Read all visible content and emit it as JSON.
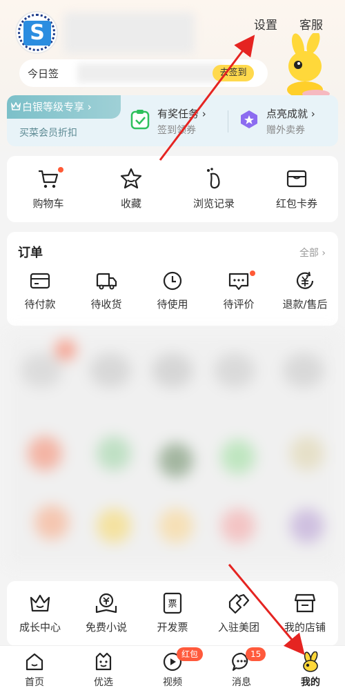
{
  "header": {
    "settings_label": "设置",
    "service_label": "客服",
    "checkin_text": "今日签",
    "checkin_button": "去签到"
  },
  "vip": {
    "tag_label": "白银等级专享 ›",
    "tag_sub": "买菜会员折扣",
    "tasks_title": "有奖任务 ›",
    "tasks_sub": "签到领券",
    "achieve_title": "点亮成就 ›",
    "achieve_sub": "赠外卖券"
  },
  "quick": {
    "items": [
      {
        "label": "购物车",
        "icon": "cart-icon"
      },
      {
        "label": "收藏",
        "icon": "star-icon"
      },
      {
        "label": "浏览记录",
        "icon": "footprint-icon"
      },
      {
        "label": "红包卡券",
        "icon": "coupon-icon"
      }
    ]
  },
  "orders": {
    "title": "订单",
    "all_label": "全部 ›",
    "items": [
      {
        "label": "待付款",
        "icon": "wallet-icon"
      },
      {
        "label": "待收货",
        "icon": "truck-icon"
      },
      {
        "label": "待使用",
        "icon": "clock-icon"
      },
      {
        "label": "待评价",
        "icon": "comment-icon"
      },
      {
        "label": "退款/售后",
        "icon": "refund-icon"
      }
    ]
  },
  "services": {
    "items": [
      {
        "label": "成长中心",
        "icon": "crown-icon"
      },
      {
        "label": "免费小说",
        "icon": "book-icon"
      },
      {
        "label": "开发票",
        "icon": "invoice-icon"
      },
      {
        "label": "入驻美团",
        "icon": "handshake-icon"
      },
      {
        "label": "我的店铺",
        "icon": "shop-icon"
      }
    ]
  },
  "tabbar": {
    "items": [
      {
        "label": "首页",
        "icon": "home-icon"
      },
      {
        "label": "优选",
        "icon": "select-icon"
      },
      {
        "label": "视频",
        "icon": "video-icon",
        "badge": "红包"
      },
      {
        "label": "消息",
        "icon": "message-icon",
        "badge": "15"
      },
      {
        "label": "我的",
        "icon": "profile-icon",
        "active": true
      }
    ]
  },
  "colors": {
    "accent_yellow": "#ffd94d",
    "badge_red": "#ff5a3c",
    "arrow_red": "#e52421",
    "vip_teal": "#7cc0c9"
  }
}
